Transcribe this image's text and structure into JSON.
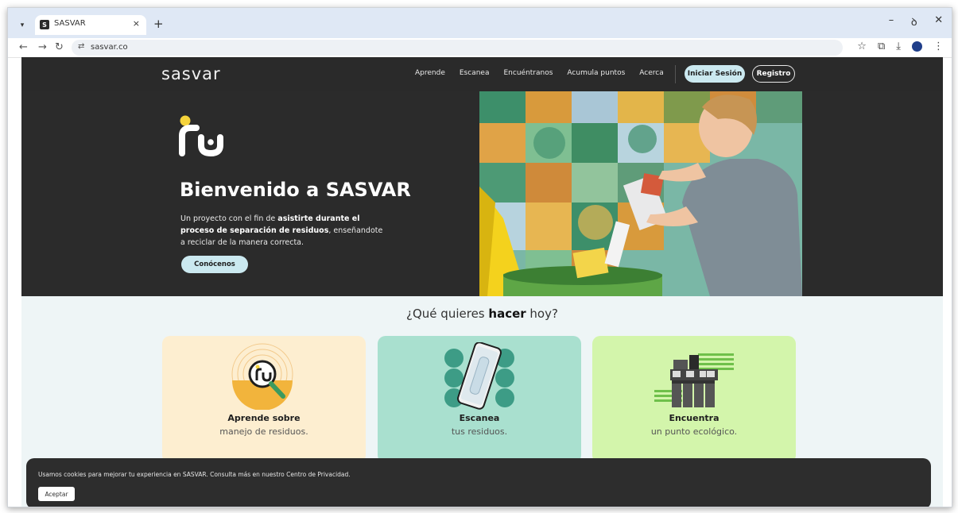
{
  "browser": {
    "tab_title": "SASVAR",
    "tab_close": "×",
    "new_tab": "+",
    "url": "sasvar.co",
    "win_min": "–",
    "win_restore": "ꝺ",
    "win_close": "✕",
    "icons": [
      "tab-search-icon",
      "back-icon",
      "forward-icon",
      "reload-icon",
      "site-settings-icon",
      "star-icon",
      "extensions-icon",
      "download-icon",
      "profile-icon",
      "menu-icon"
    ]
  },
  "nav": {
    "logo": "sasvar",
    "links": [
      "Aprende",
      "Escanea",
      "Encuéntranos",
      "Acumula puntos",
      "Acerca"
    ],
    "login": "Iniciar Sesión",
    "register": "Registro"
  },
  "hero": {
    "title": "Bienvenido a SASVAR",
    "text_1": "Un proyecto con el fin de ",
    "text_bold": "asistirte durante el proceso de separación de residuos",
    "text_2": ", enseñandote a reciclar de la manera correcta.",
    "cta": "Conócenos"
  },
  "question": {
    "prefix": "¿Qué quieres ",
    "bold": "hacer",
    "suffix": " hoy?"
  },
  "cards": [
    {
      "title": "Aprende sobre",
      "subtitle": "manejo de residuos.",
      "color": "#fdeed0"
    },
    {
      "title": "Escanea",
      "subtitle": "tus residuos.",
      "color": "#a9e0cf"
    },
    {
      "title": "Encuentra",
      "subtitle": "un punto ecológico.",
      "color": "#d3f5ab"
    }
  ],
  "cookie": {
    "text": "Usamos cookies para mejorar tu experiencia en SASVAR. Consulta más en nuestro Centro de Privacidad.",
    "accept": "Aceptar"
  },
  "colors": {
    "dark": "#2b2b2b",
    "accent": "#cbe9f0",
    "yellow": "#f5d33b",
    "teal": "#3d9c86"
  }
}
